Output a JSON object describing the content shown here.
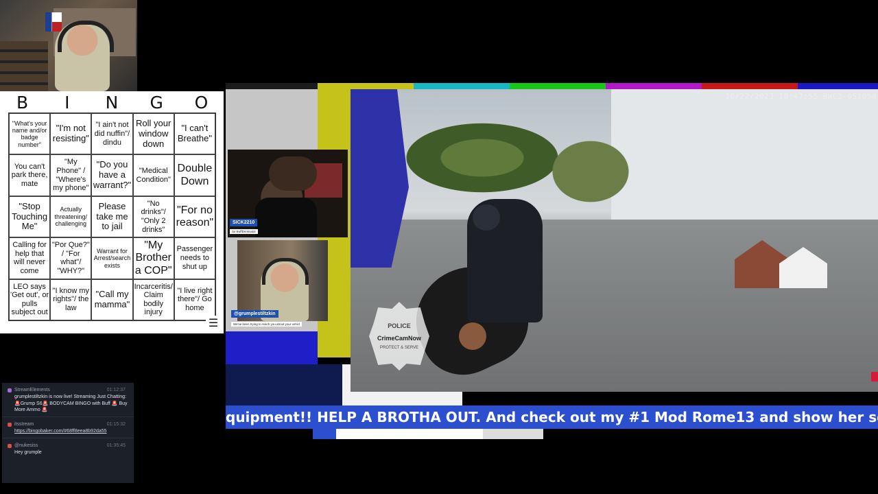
{
  "bingo": {
    "letters": [
      "B",
      "I",
      "N",
      "G",
      "O"
    ],
    "cells": [
      "\"What's your name and/or badge number\"",
      "\"I'm not resisting\"",
      "\"I ain't not did nuffin\"/ dindu",
      "Roll your window down",
      "\"I can't Breathe\"",
      "You can't park there, mate",
      "\"My Phone\" / \"Where's my phone\"",
      "\"Do you have a warrant?\"",
      "\"Medical Condition\"",
      "Double Down",
      "\"Stop Touching Me\"",
      "Actually threatening/ challenging",
      "Please take me to jail",
      "\"No drinks\"/ \"Only 2 drinks\"",
      "\"For no reason\"",
      "Calling for help that will never come",
      "\"Por Que?\" / \"For what\"/ \"WHY?\"",
      "Warrant for Arrest/search exists",
      "\"My Brother a COP\"",
      "Passenger needs to shut up",
      "LEO says 'Get out', or pulls subject out",
      "\"I know my rights\"/ the law",
      "\"Call my mamma\"",
      "Incarceritis/ Claim bodily injury",
      "\"I live right there\"/ Go home"
    ],
    "menu_icon": "hamburger-icon"
  },
  "chat": {
    "messages": [
      {
        "user": "StreamElements",
        "time": "01:12:37",
        "text": "grumplestiltzkin is now live! Streaming Just Chatting: 🚨Grump S6🚨 BODYCAM BINGO with Buff 🚨 Buy More Ammo 🚨",
        "color": "#a36bd6"
      },
      {
        "user": "itsstream",
        "time": "01:15:32",
        "text": "https://bingobaker.com/#68ff8eea8b92da55",
        "color": "#e24b4b"
      },
      {
        "user": "@nukesiss",
        "time": "01:35:45",
        "text": "Hey grumple",
        "color": "#e24b4b"
      }
    ]
  },
  "guest": {
    "name": "SICK2210",
    "subtitle": "Sir BuffDrinksalot"
  },
  "host": {
    "name": "@grumplestiltzkin",
    "subtitle": "We've been trying to reach you about your vehicl"
  },
  "bodycam": {
    "timestamp": "10/22/2023 10:47:55 BWC2-051058",
    "watermark": {
      "top": "POLICE",
      "middle": "CrimeCamNow",
      "bottom": "PROTECT & SERVE"
    }
  },
  "ticker": {
    "text": "quipment!! HELP A BROTHA OUT. And check out my #1 Mod Rome13 and show her some love for all she"
  },
  "progress": {
    "fraction": 0.1
  },
  "colors": {
    "bars": [
      "#1b1b1b",
      "#c6c219",
      "#19b6c6",
      "#19c619",
      "#b219c6",
      "#c61919",
      "#1919c6"
    ],
    "accent_blue": "#2b4fcf"
  }
}
